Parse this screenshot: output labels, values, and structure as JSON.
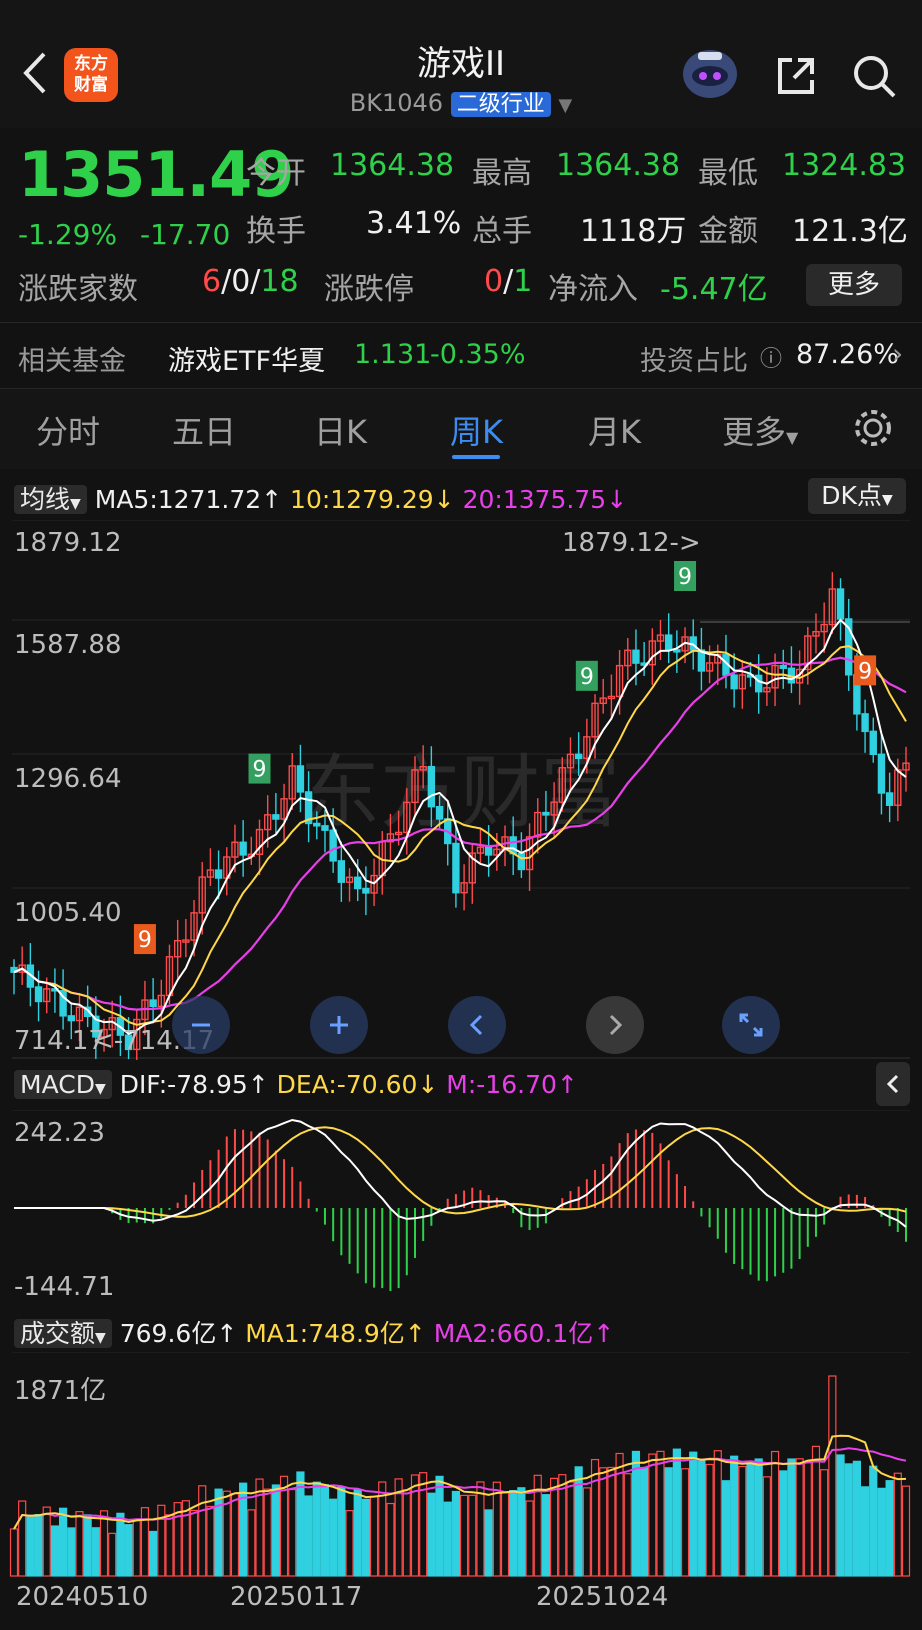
{
  "header": {
    "title": "游戏II",
    "code": "BK1046",
    "tag": "二级行业",
    "logo_text_line1": "东方",
    "logo_text_line2": "财富"
  },
  "quote": {
    "price": "1351.49",
    "change_pct": "-1.29%",
    "change_abs": "-17.70",
    "open_label": "今开",
    "open": "1364.38",
    "high_label": "最高",
    "high": "1364.38",
    "low_label": "最低",
    "low": "1324.83",
    "turnover_label": "换手",
    "turnover": "3.41%",
    "volume_label": "总手",
    "volume": "1118万",
    "amount_label": "金额",
    "amount": "121.3亿",
    "updown_label": "涨跌家数",
    "up": "6",
    "flat": "0",
    "down": "18",
    "limit_label": "涨跌停",
    "limit_up": "0",
    "limit_down": "1",
    "inflow_label": "净流入",
    "inflow": "-5.47亿",
    "more": "更多"
  },
  "fund": {
    "label": "相关基金",
    "name": "游戏ETF华夏",
    "price": "1.131",
    "change": "-0.35%",
    "ratio_label": "投资占比",
    "ratio": "87.26%"
  },
  "tabs": [
    "分时",
    "五日",
    "日K",
    "周K",
    "月K",
    "更多"
  ],
  "active_tab": "周K",
  "ma_row": {
    "selector": "均线",
    "ma5": "MA5:1271.72↑",
    "ma10": "10:1279.29↓",
    "ma20": "20:1375.75↓",
    "dk": "DK点"
  },
  "kline_axis": [
    "1879.12",
    "1587.88",
    "1296.64",
    "1005.40",
    "714.17"
  ],
  "kline_annotations": {
    "high": "1879.12->",
    "low": "<-714.17"
  },
  "macd_row": {
    "selector": "MACD",
    "dif": "DIF:-78.95↑",
    "dea": "DEA:-70.60↓",
    "m": "M:-16.70↑"
  },
  "macd_axis": [
    "242.23",
    "-144.71"
  ],
  "vol_row": {
    "selector": "成交额",
    "value": "769.6亿↑",
    "ma1": "MA1:748.9亿↑",
    "ma2": "MA2:660.1亿↑"
  },
  "vol_axis": [
    "1871亿"
  ],
  "dates": [
    "20240510",
    "20250117",
    "20251024"
  ],
  "watermark": "东方财富",
  "colors": {
    "up": "#ff4a4a",
    "down": "#2fd04a",
    "candle_down": "#2fd0e0",
    "ma5": "#ffffff",
    "ma10": "#ffd84a",
    "ma20": "#e840e8",
    "accent": "#3d8cf0"
  }
}
